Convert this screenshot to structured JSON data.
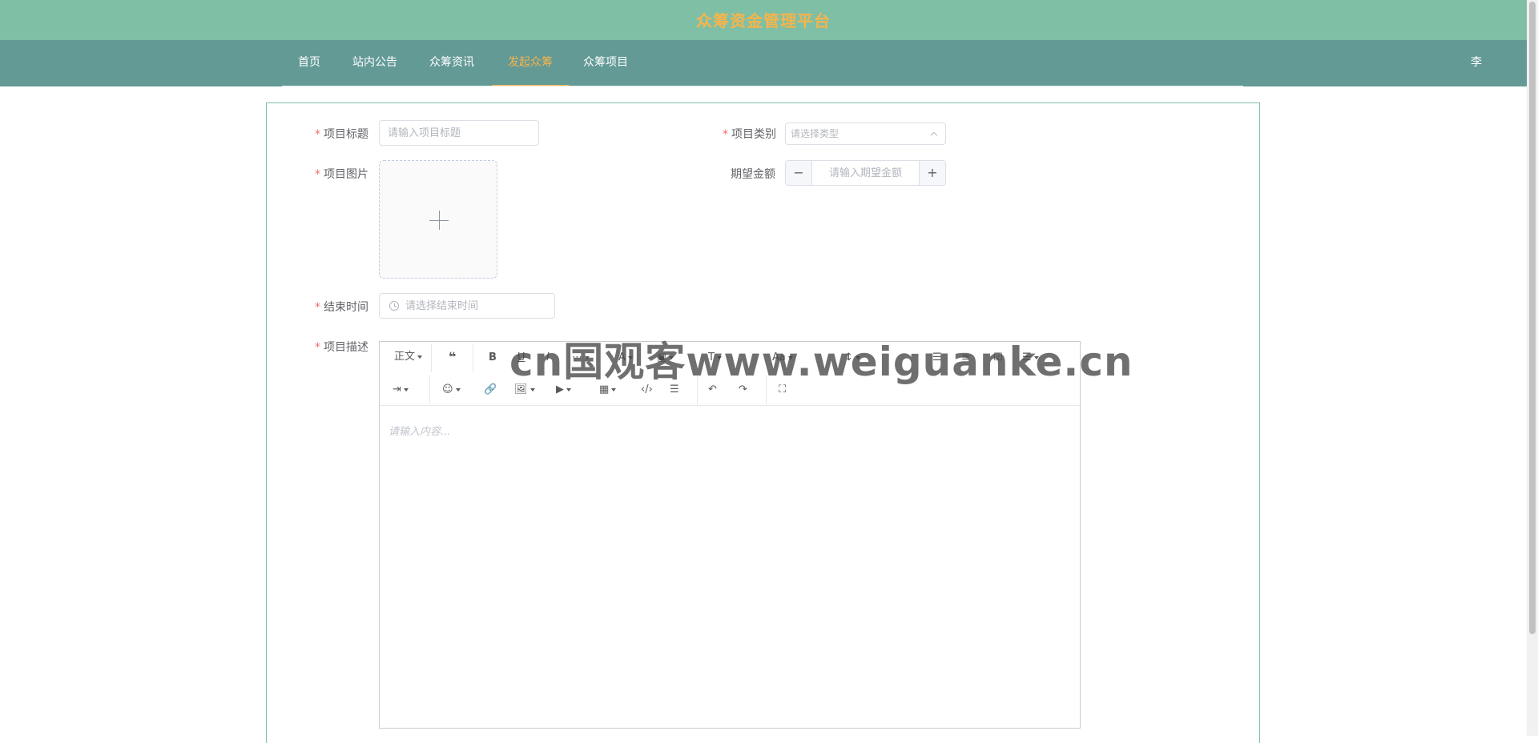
{
  "header": {
    "title": "众筹资金管理平台"
  },
  "nav": {
    "items": [
      {
        "label": "首页"
      },
      {
        "label": "站内公告"
      },
      {
        "label": "众筹资讯"
      },
      {
        "label": "发起众筹"
      },
      {
        "label": "众筹项目"
      }
    ],
    "active_index": 3,
    "user": "李四"
  },
  "colors": {
    "banner": "#7fbfa5",
    "nav": "#639a96",
    "accent": "#f6b44c",
    "required": "#f56c6c"
  },
  "form": {
    "title_label": "项目标题",
    "title_placeholder": "请输入项目标题",
    "category_label": "项目类别",
    "category_placeholder": "请选择类型",
    "image_label": "项目图片",
    "amount_label": "期望金额",
    "amount_placeholder": "请输入期望金额",
    "amount_minus": "−",
    "amount_plus": "+",
    "end_time_label": "结束时间",
    "end_time_placeholder": "请选择结束时间",
    "desc_label": "项目描述",
    "required_mark": "*"
  },
  "editor": {
    "heading_select": "正文",
    "bold": "B",
    "underline": "U",
    "placeholder": "请输入内容..."
  },
  "watermark": "cn国观客www.weiguanke.cn"
}
